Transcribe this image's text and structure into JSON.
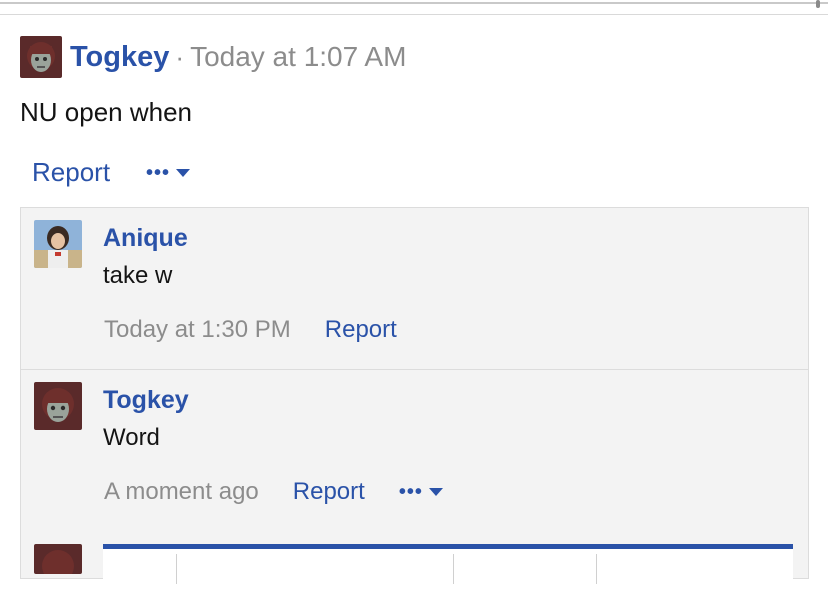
{
  "post": {
    "author": "Togkey",
    "separator": "·",
    "time": "Today at 1:07 AM",
    "body": "NU open when",
    "report_label": "Report",
    "more_glyph": "•••"
  },
  "comments": [
    {
      "author": "Anique",
      "text": "take w",
      "time": "Today at 1:30 PM",
      "report_label": "Report"
    },
    {
      "author": "Togkey",
      "text": "Word",
      "time": "A moment ago",
      "report_label": "Report",
      "more_glyph": "•••"
    }
  ],
  "colors": {
    "link": "#2a52a8",
    "muted": "#8c8c8c",
    "comment_bg": "#f3f3f3"
  },
  "icons": [
    "avatar",
    "more-dots-icon",
    "caret-down-icon"
  ]
}
